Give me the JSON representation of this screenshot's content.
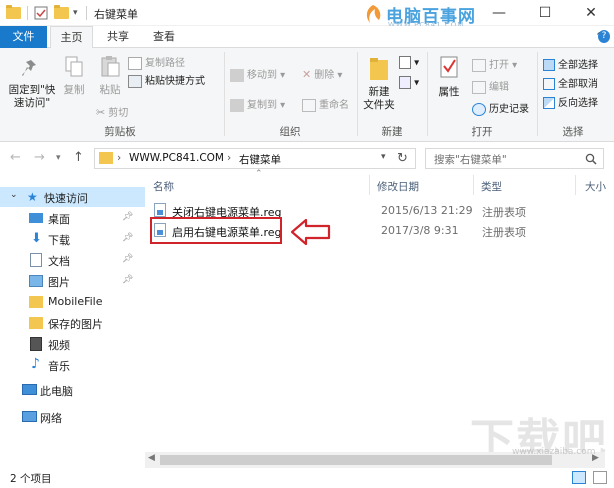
{
  "window": {
    "title": "右键菜单",
    "minimize": "—",
    "maximize": "☐",
    "close": "✕"
  },
  "watermark_logo": {
    "text": "电脑百事网",
    "url": "WWW.PC841.COM"
  },
  "ribbon_tabs": [
    {
      "label": "文件"
    },
    {
      "label": "主页"
    },
    {
      "label": "共享"
    },
    {
      "label": "查看"
    }
  ],
  "clipboard": {
    "pin_label": "固定到\"快速访问\"",
    "copy": "复制",
    "paste": "粘贴",
    "copy_path": "复制路径",
    "paste_shortcut": "粘贴快捷方式",
    "cut": "剪切",
    "group": "剪贴板"
  },
  "organize": {
    "move_to": "移动到",
    "copy_to": "复制到",
    "delete": "删除",
    "rename": "重命名",
    "group": "组织"
  },
  "new": {
    "new_folder": "新建\n文件夹",
    "group": "新建"
  },
  "open": {
    "properties": "属性",
    "open": "打开",
    "edit": "编辑",
    "history": "历史记录",
    "group": "打开"
  },
  "select": {
    "select_all": "全部选择",
    "select_none": "全部取消",
    "invert": "反向选择",
    "group": "选择"
  },
  "address": {
    "crumb1": "WWW.PC841.COM",
    "crumb2": "右键菜单",
    "separator": "›",
    "search_placeholder": "搜索\"右键菜单\""
  },
  "sidebar": {
    "quick_access": "快速访问",
    "items": [
      {
        "label": "桌面",
        "pinned": true
      },
      {
        "label": "下载",
        "pinned": true
      },
      {
        "label": "文档",
        "pinned": true
      },
      {
        "label": "图片",
        "pinned": true
      },
      {
        "label": "MobileFile",
        "pinned": false
      },
      {
        "label": "保存的图片",
        "pinned": false
      },
      {
        "label": "视频",
        "pinned": false
      },
      {
        "label": "音乐",
        "pinned": false
      }
    ],
    "this_pc": "此电脑",
    "network": "网络"
  },
  "columns": {
    "name": "名称",
    "date": "修改日期",
    "type": "类型",
    "size": "大小"
  },
  "files": [
    {
      "name": "关闭右键电源菜单.reg",
      "date": "2015/6/13 21:29",
      "type": "注册表项"
    },
    {
      "name": "启用右键电源菜单.reg",
      "date": "2017/3/8 9:31",
      "type": "注册表项"
    }
  ],
  "status": {
    "count": "2 个项目"
  },
  "watermark_bottom": {
    "text": "下载吧",
    "url": "www.xiazaiba.com"
  },
  "colors": {
    "file_tab": "#1979ca",
    "highlight": "#d1232a",
    "selected": "#cce8ff",
    "accent": "#2b83d6"
  }
}
